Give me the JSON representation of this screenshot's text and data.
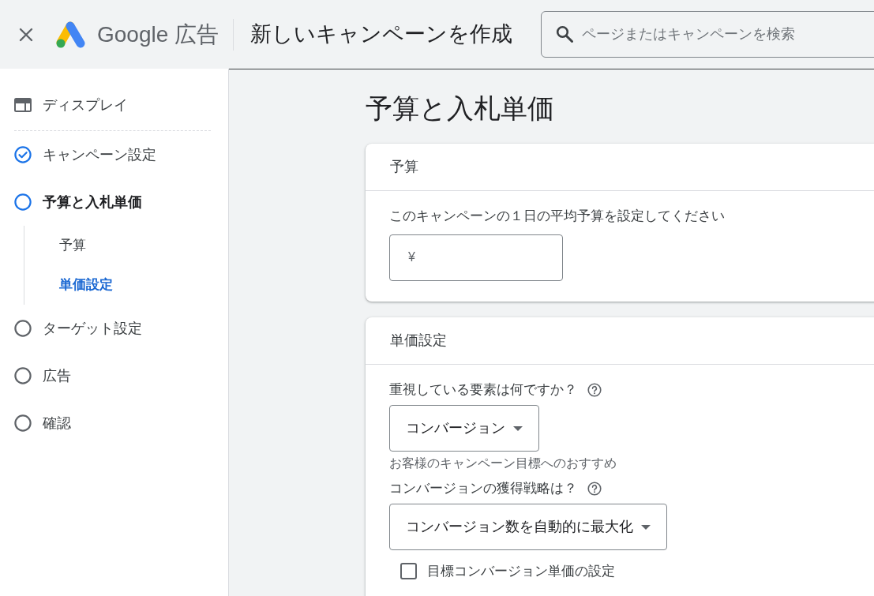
{
  "header": {
    "brand": "Google 広告",
    "title": "新しいキャンペーンを作成",
    "search": {
      "placeholder": "ページまたはキャンペーンを検索"
    }
  },
  "sidebar": {
    "campaign_type": "ディスプレイ",
    "steps": [
      {
        "label": "キャンペーン設定",
        "completed": true,
        "selected": false
      },
      {
        "label": "予算と入札単価",
        "completed": false,
        "selected": true,
        "children": [
          {
            "label": "予算",
            "selected": false
          },
          {
            "label": "単価設定",
            "selected": true
          }
        ]
      },
      {
        "label": "ターゲット設定",
        "completed": false,
        "selected": false
      },
      {
        "label": "広告",
        "completed": false,
        "selected": false
      },
      {
        "label": "確認",
        "completed": false,
        "selected": false
      }
    ]
  },
  "main": {
    "heading": "予算と入札単価",
    "cards": [
      {
        "title": "予算",
        "items": [
          {
            "kind": "label",
            "text": "このキャンペーンの１日の平均予算を設定してください",
            "help": false
          },
          {
            "kind": "currency_input",
            "prefix": "¥"
          }
        ]
      },
      {
        "title": "単価設定",
        "items": [
          {
            "kind": "label",
            "text": "重視している要素は何ですか？",
            "help": true
          },
          {
            "kind": "select",
            "value": "コンバージョン"
          },
          {
            "kind": "hint",
            "text": "お客様のキャンペーン目標へのおすすめ"
          },
          {
            "kind": "label",
            "text": "コンバージョンの獲得戦略は？",
            "help": true
          },
          {
            "kind": "select",
            "value": "コンバージョン数を自動的に最大化"
          },
          {
            "kind": "checkbox",
            "label": "目標コンバージョン単価の設定",
            "checked": false
          }
        ]
      }
    ]
  }
}
